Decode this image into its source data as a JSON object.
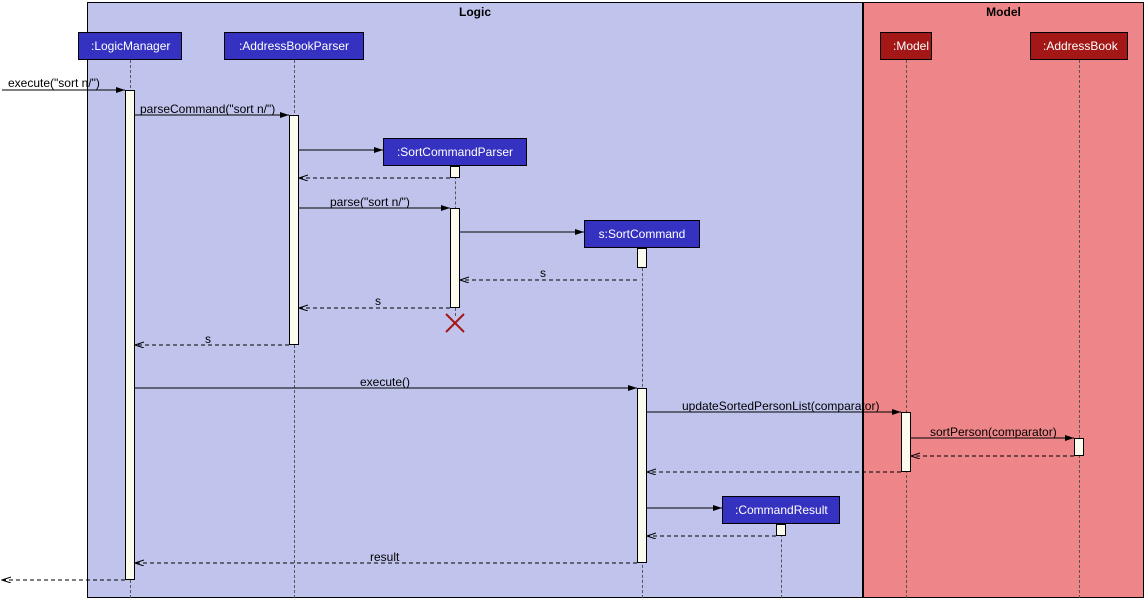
{
  "frames": {
    "logic": {
      "label": "Logic"
    },
    "model": {
      "label": "Model"
    }
  },
  "participants": {
    "logicManager": ":LogicManager",
    "addressBookParser": ":AddressBookParser",
    "sortCommandParser": ":SortCommandParser",
    "sortCommand": "s:SortCommand",
    "commandResult": ":CommandResult",
    "model": ":Model",
    "addressBook": ":AddressBook"
  },
  "messages": {
    "executeSort": "execute(\"sort n/\")",
    "parseCommand": "parseCommand(\"sort n/\")",
    "parseSort": "parse(\"sort n/\")",
    "returnS1": "s",
    "returnS2": "s",
    "returnS3": "s",
    "execute": "execute()",
    "updateSorted": "updateSortedPersonList(comparator)",
    "sortPerson": "sortPerson(comparator)",
    "result": "result"
  },
  "chart_data": {
    "type": "sequence_diagram",
    "frames": [
      "Logic",
      "Model"
    ],
    "participants": [
      {
        "name": ":LogicManager",
        "frame": "Logic"
      },
      {
        "name": ":AddressBookParser",
        "frame": "Logic"
      },
      {
        "name": ":SortCommandParser",
        "frame": "Logic",
        "created_during": true,
        "destroyed_during": true
      },
      {
        "name": "s:SortCommand",
        "frame": "Logic",
        "created_during": true
      },
      {
        "name": ":CommandResult",
        "frame": "Logic",
        "created_during": true
      },
      {
        "name": ":Model",
        "frame": "Model"
      },
      {
        "name": ":AddressBook",
        "frame": "Model"
      }
    ],
    "messages": [
      {
        "from": "external",
        "to": ":LogicManager",
        "label": "execute(\"sort n/\")",
        "type": "sync"
      },
      {
        "from": ":LogicManager",
        "to": ":AddressBookParser",
        "label": "parseCommand(\"sort n/\")",
        "type": "sync"
      },
      {
        "from": ":AddressBookParser",
        "to": ":SortCommandParser",
        "label": "",
        "type": "create"
      },
      {
        "from": ":SortCommandParser",
        "to": ":AddressBookParser",
        "label": "",
        "type": "return"
      },
      {
        "from": ":AddressBookParser",
        "to": ":SortCommandParser",
        "label": "parse(\"sort n/\")",
        "type": "sync"
      },
      {
        "from": ":SortCommandParser",
        "to": "s:SortCommand",
        "label": "",
        "type": "create"
      },
      {
        "from": "s:SortCommand",
        "to": ":SortCommandParser",
        "label": "s",
        "type": "return"
      },
      {
        "from": ":SortCommandParser",
        "to": ":AddressBookParser",
        "label": "s",
        "type": "return"
      },
      {
        "from": ":SortCommandParser",
        "to": null,
        "label": "",
        "type": "destroy"
      },
      {
        "from": ":AddressBookParser",
        "to": ":LogicManager",
        "label": "s",
        "type": "return"
      },
      {
        "from": ":LogicManager",
        "to": "s:SortCommand",
        "label": "execute()",
        "type": "sync"
      },
      {
        "from": "s:SortCommand",
        "to": ":Model",
        "label": "updateSortedPersonList(comparator)",
        "type": "sync"
      },
      {
        "from": ":Model",
        "to": ":AddressBook",
        "label": "sortPerson(comparator)",
        "type": "sync"
      },
      {
        "from": ":AddressBook",
        "to": ":Model",
        "label": "",
        "type": "return"
      },
      {
        "from": ":Model",
        "to": "s:SortCommand",
        "label": "",
        "type": "return"
      },
      {
        "from": "s:SortCommand",
        "to": ":CommandResult",
        "label": "",
        "type": "create"
      },
      {
        "from": ":CommandResult",
        "to": "s:SortCommand",
        "label": "",
        "type": "return"
      },
      {
        "from": "s:SortCommand",
        "to": ":LogicManager",
        "label": "result",
        "type": "return"
      },
      {
        "from": ":LogicManager",
        "to": "external",
        "label": "",
        "type": "return"
      }
    ]
  }
}
